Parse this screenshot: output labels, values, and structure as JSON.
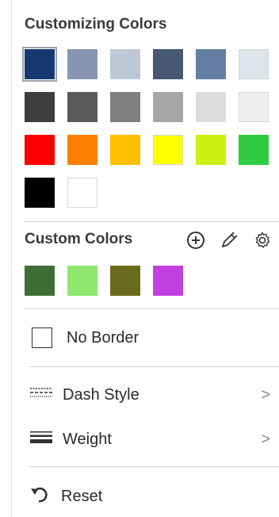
{
  "sections": {
    "customizing_title": "Customizing Colors",
    "custom_title": "Custom Colors"
  },
  "palette": [
    [
      "#163a70",
      "#8797b3",
      "#bfc8d6",
      "#465872",
      "#647fa3",
      "#dfe4eb"
    ],
    [
      "#3d3d3d",
      "#5a5a5a",
      "#808080",
      "#a6a6a6",
      "#dcdcdc",
      "#efefef"
    ],
    [
      "#ff0000",
      "#ff7f00",
      "#ffc000",
      "#ffff00",
      "#ccf00f",
      "#2ecc40"
    ],
    [
      "#000000",
      "#ffffff"
    ]
  ],
  "custom_colors": [
    "#3f6e34",
    "#8ee66c",
    "#6b6b1f",
    "#c040e0"
  ],
  "icons": {
    "add": "add-circle-icon",
    "eyedropper": "eyedropper-icon",
    "settings": "gear-icon",
    "dash": "dash-style-icon",
    "weight": "weight-icon",
    "reset": "undo-icon",
    "chevron": "chevron-right-icon"
  },
  "menu": {
    "no_border": "No Border",
    "dash_style": "Dash Style",
    "weight": "Weight",
    "reset": "Reset",
    "chevron": ">"
  }
}
